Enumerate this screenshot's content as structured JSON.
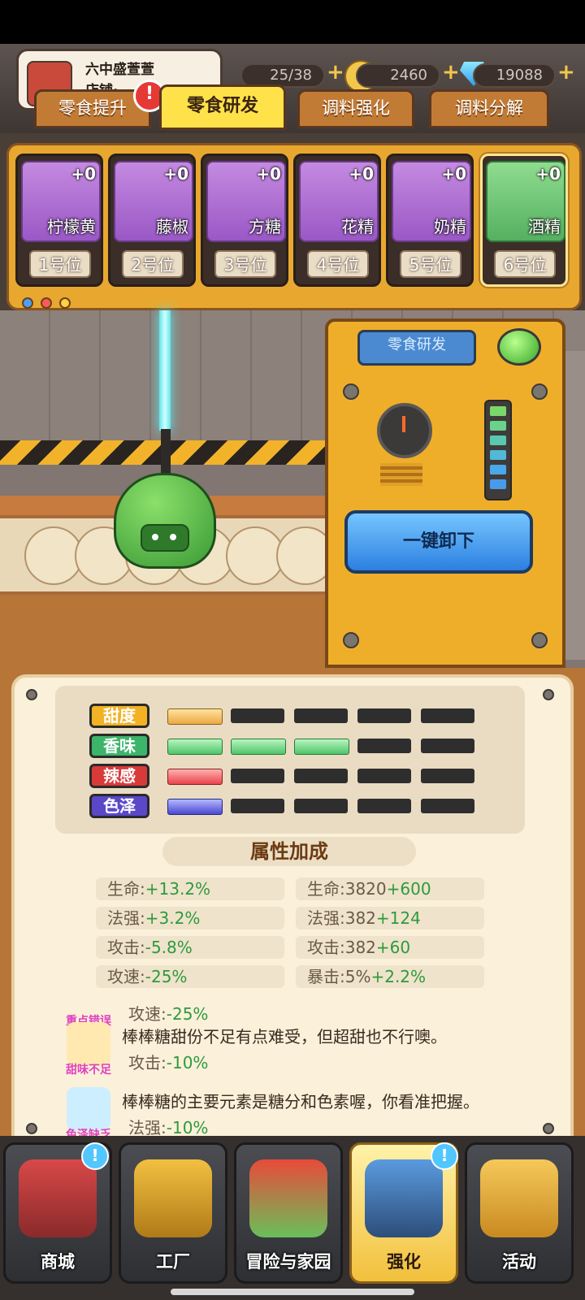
{
  "profile": {
    "name": "六中盛萱萱",
    "subtitle": "店铺·"
  },
  "resources": [
    {
      "icon": "energy-icon",
      "value": "25/38"
    },
    {
      "icon": "coin-icon",
      "value": "2460"
    },
    {
      "icon": "diamond-icon",
      "value": "19088"
    }
  ],
  "tabs": [
    {
      "label": "零食提升"
    },
    {
      "label": "零食研发"
    },
    {
      "label": "调料强化"
    },
    {
      "label": "调料分解"
    }
  ],
  "alert_mark": "!",
  "slots": [
    {
      "name": "柠檬黄",
      "plus": "+0",
      "pos": "1号位"
    },
    {
      "name": "藤椒",
      "plus": "+0",
      "pos": "2号位"
    },
    {
      "name": "方糖",
      "plus": "+0",
      "pos": "3号位"
    },
    {
      "name": "花精",
      "plus": "+0",
      "pos": "4号位"
    },
    {
      "name": "奶精",
      "plus": "+0",
      "pos": "5号位"
    },
    {
      "name": "酒精",
      "plus": "+0",
      "pos": "6号位"
    }
  ],
  "machine": {
    "label": "零食研发",
    "unload_label": "一键卸下"
  },
  "attributes": [
    {
      "label": "甜度",
      "color": "#f2b224",
      "filled": 1
    },
    {
      "label": "香味",
      "color": "#3cb46a",
      "filled": 3
    },
    {
      "label": "辣感",
      "color": "#d83a3a",
      "filled": 1
    },
    {
      "label": "色泽",
      "color": "#5a48c8",
      "filled": 1
    }
  ],
  "bonus_title": "属性加成",
  "stats_left": [
    {
      "name": "生命:",
      "value": "+13.2%"
    },
    {
      "name": "法强:",
      "value": "+3.2%"
    },
    {
      "name": "攻击:",
      "value": "-5.8%"
    },
    {
      "name": "攻速:",
      "value": "-25%"
    }
  ],
  "stats_right": [
    {
      "name": "生命:3820",
      "bonus": "+600"
    },
    {
      "name": "法强:382",
      "bonus": "+124"
    },
    {
      "name": "攻击:382",
      "bonus": "+60"
    },
    {
      "name": "暴击:5%",
      "bonus": "+2.2%"
    }
  ],
  "messages": [
    {
      "tag": "重点错误",
      "text": "",
      "effect_name": "攻速:",
      "effect_value": "-25%"
    },
    {
      "tag": "甜味不足",
      "text": "棒棒糖甜份不足有点难受，但超甜也不行噢。",
      "effect_name": "攻击:",
      "effect_value": "-10%"
    },
    {
      "tag": "色泽缺乏",
      "text": "棒棒糖的主要元素是糖分和色素喔，你看准把握。",
      "effect_name": "法强:",
      "effect_value": "-10%"
    }
  ],
  "nav": [
    {
      "label": "商城"
    },
    {
      "label": "工厂"
    },
    {
      "label": "冒险与家园"
    },
    {
      "label": "强化"
    },
    {
      "label": "活动"
    }
  ],
  "notif_mark": "!"
}
